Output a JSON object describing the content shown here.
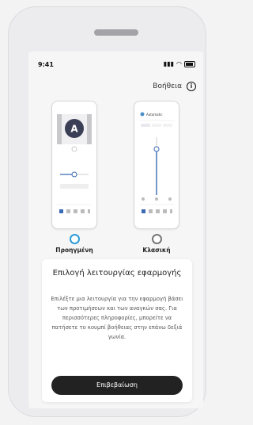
{
  "status": {
    "time": "9:41"
  },
  "help": {
    "label": "Βοήθεια",
    "icon": "info-icon"
  },
  "options": [
    {
      "label": "Προηγμένη",
      "selected": true,
      "preview_badge": "A"
    },
    {
      "label": "Κλασική",
      "selected": false,
      "preview_header": "Automatic"
    }
  ],
  "card": {
    "title": "Επιλογή λειτουργίας εφαρμογής",
    "description": "Επιλέξτε μια λειτουργία για την εφαρμογή βάσει των προτιμήσεων και των αναγκών σας. Για περισσότερες πληροφορίες, μπορείτε να πατήσετε το κουμπί βοήθειας στην επάνω δεξιά γωνία.",
    "button": "Επιβεβαίωση"
  },
  "colors": {
    "accent": "#2d9bd8",
    "button_bg": "#222222"
  }
}
